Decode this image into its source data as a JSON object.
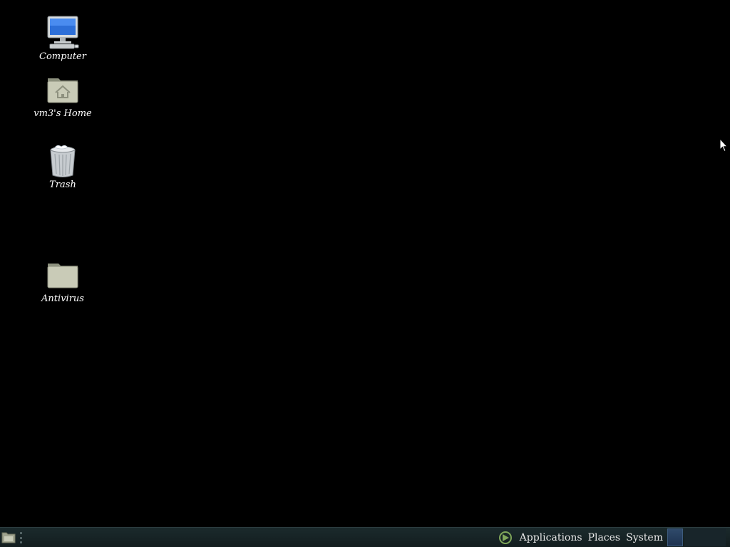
{
  "desktop": {
    "background_color": "#000000",
    "icons": [
      {
        "label": "Computer",
        "icon": "computer-icon"
      },
      {
        "label": "vm3's Home",
        "icon": "home-folder-icon"
      },
      {
        "label": "Trash",
        "icon": "trash-icon"
      },
      {
        "label": "Antivirus",
        "icon": "folder-icon"
      }
    ]
  },
  "panel": {
    "show_desktop_icon": "show-desktop-icon",
    "menus": {
      "logo_icon": "distro-logo-icon",
      "applications": "Applications",
      "places": "Places",
      "system": "System"
    }
  }
}
